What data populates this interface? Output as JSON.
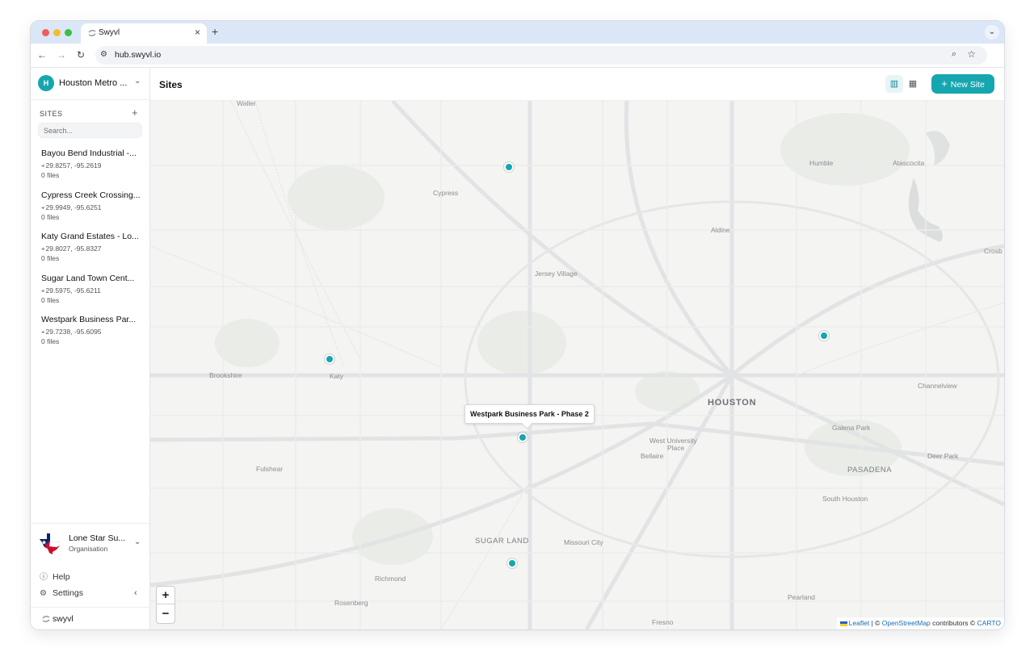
{
  "browser": {
    "tab_title": "Swyvl",
    "url": "hub.swyvl.io"
  },
  "workspace": {
    "avatar_letter": "H",
    "name": "Houston Metro ..."
  },
  "sidebar": {
    "sites_header": "SITES",
    "search_placeholder": "Search...",
    "sites": [
      {
        "name": "Bayou Bend Industrial -...",
        "coords": "29.8257, -95.2619",
        "files": "0 files"
      },
      {
        "name": "Cypress Creek Crossing...",
        "coords": "29.9949, -95.6251",
        "files": "0 files"
      },
      {
        "name": "Katy Grand Estates - Lo...",
        "coords": "29.8027, -95.8327",
        "files": "0 files"
      },
      {
        "name": "Sugar Land Town Cent...",
        "coords": "29.5975, -95.6211",
        "files": "0 files"
      },
      {
        "name": "Westpark Business Par...",
        "coords": "29.7238, -95.6095",
        "files": "0 files"
      }
    ],
    "org": {
      "name": "Lone Star Su...",
      "type": "Organisation"
    },
    "help_label": "Help",
    "settings_label": "Settings",
    "brand": "swyvl"
  },
  "main": {
    "title": "Sites",
    "new_site_label": "New Site"
  },
  "map": {
    "tooltip": "Westpark Business Park - Phase 2",
    "places": {
      "waller": "Waller",
      "cypress": "Cypress",
      "humble": "Humble",
      "atascocita": "Atascocita",
      "aldine": "Aldine",
      "crosby": "Crosb",
      "jersey_village": "Jersey Village",
      "brookshire": "Brookshire",
      "katy": "Katy",
      "channelview": "Channelview",
      "houston": "HOUSTON",
      "galena_park": "Galena Park",
      "west_university_1": "West University",
      "west_university_2": "Place",
      "bellaire": "Bellaire",
      "fulshear": "Fulshear",
      "pasadena": "PASADENA",
      "deer_park": "Deer Park",
      "south_houston": "South Houston",
      "sugar_land": "SUGAR LAND",
      "missouri_city": "Missouri City",
      "richmond": "Richmond",
      "rosenberg": "Rosenberg",
      "pearland": "Pearland",
      "fresno": "Fresno"
    },
    "zoom_in": "+",
    "zoom_out": "−",
    "attribution": {
      "leaflet": "Leaflet",
      "sep": " | © ",
      "osm": "OpenStreetMap",
      "contributors": " contributors © ",
      "carto": "CARTO"
    }
  },
  "colors": {
    "accent": "#16a6b0"
  }
}
